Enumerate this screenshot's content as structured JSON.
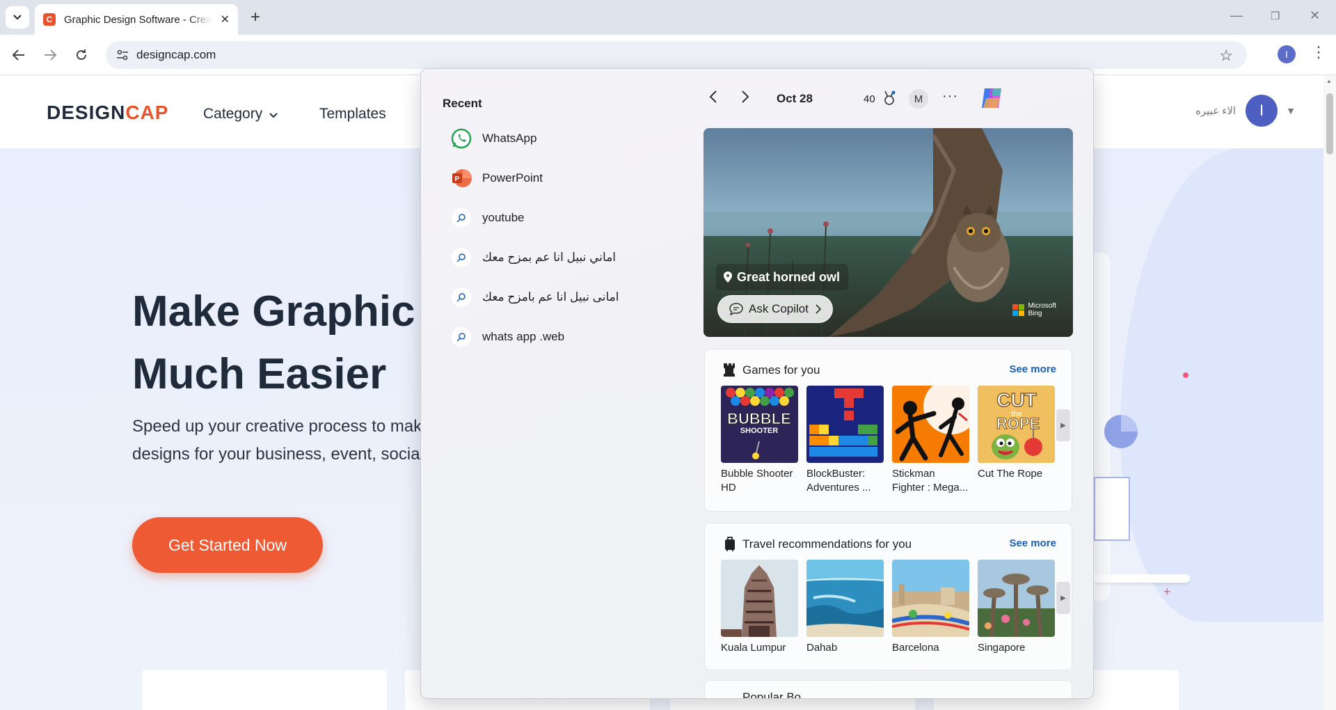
{
  "browser": {
    "tab_title": "Graphic Design Software - Crea",
    "url": "designcap.com",
    "profile_initial": "I"
  },
  "site": {
    "logo_design": "DESIGN",
    "logo_cap": "CAP",
    "nav": [
      "Category",
      "Templates"
    ],
    "user_name": "الاء عبيره",
    "user_initial": "I",
    "hero_title_line1": "Make Graphic I",
    "hero_title_line2": "Much Easier",
    "hero_sub_line1": "Speed up your creative process to make",
    "hero_sub_line2": "designs for your business, event, social",
    "cta_label": "Get Started Now"
  },
  "widgets": {
    "recent_heading": "Recent",
    "recent": [
      {
        "label": "WhatsApp",
        "icon": "whatsapp-icon"
      },
      {
        "label": "PowerPoint",
        "icon": "powerpoint-icon"
      },
      {
        "label": "youtube",
        "icon": "search-icon"
      },
      {
        "label": "اماني نبيل انا عم بمزح معك",
        "icon": "search-icon"
      },
      {
        "label": "امانى نبيل انا عم بامزح معك",
        "icon": "search-icon"
      },
      {
        "label": "whats app .web",
        "icon": "search-icon"
      }
    ],
    "date": "Oct 28",
    "points": "40",
    "avatar_initial": "M",
    "hero_caption": "Great horned owl",
    "ask_copilot": "Ask Copilot",
    "bing_line1": "Microsoft",
    "bing_line2": "Bing",
    "games": {
      "title": "Games for you",
      "see_more": "See more",
      "items": [
        {
          "label": "Bubble Shooter HD"
        },
        {
          "label": "BlockBuster: Adventures ..."
        },
        {
          "label": "Stickman Fighter : Mega..."
        },
        {
          "label": "Cut The Rope"
        }
      ]
    },
    "travel": {
      "title": "Travel recommendations for you",
      "see_more": "See more",
      "items": [
        {
          "label": "Kuala Lumpur"
        },
        {
          "label": "Dahab"
        },
        {
          "label": "Barcelona"
        },
        {
          "label": "Singapore"
        }
      ]
    },
    "next_section_title": "Popular Bo..."
  },
  "colors": {
    "accent": "#e8532b",
    "link": "#1a5fb4",
    "avatar": "#4e5fc2"
  }
}
